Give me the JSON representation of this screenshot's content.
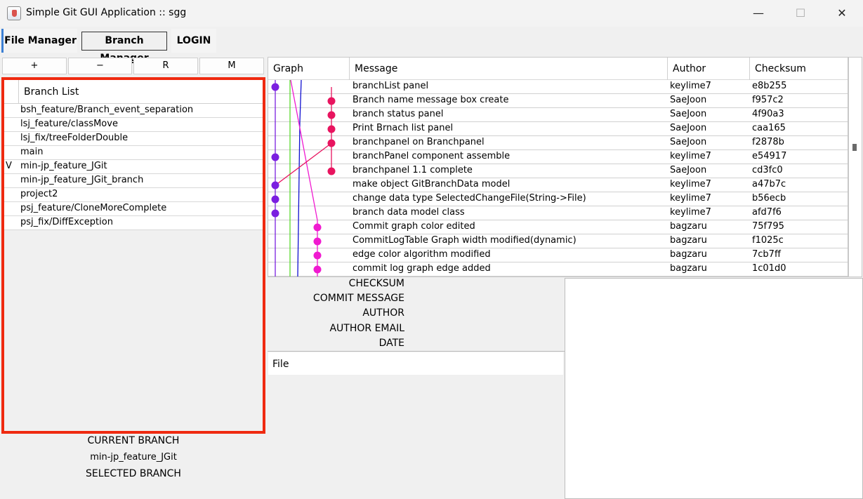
{
  "window": {
    "title": "Simple Git GUI Application :: sgg",
    "minimize": "—",
    "maximize": "☐",
    "close": "✕"
  },
  "tabs": [
    {
      "label": "File Manager"
    },
    {
      "label": "Branch Manager"
    },
    {
      "label": "LOGIN"
    }
  ],
  "branch_buttons": {
    "add": "+",
    "remove": "−",
    "rename": "R",
    "merge": "M"
  },
  "branch_list": {
    "header": "Branch List",
    "items": [
      {
        "mark": "",
        "name": "bsh_feature/Branch_event_separation"
      },
      {
        "mark": "",
        "name": "lsj_feature/classMove"
      },
      {
        "mark": "",
        "name": "lsj_fix/treeFolderDouble"
      },
      {
        "mark": "",
        "name": "main"
      },
      {
        "mark": "V",
        "name": "min-jp_feature_JGit"
      },
      {
        "mark": "",
        "name": "min-jp_feature_JGit_branch"
      },
      {
        "mark": "",
        "name": "project2"
      },
      {
        "mark": "",
        "name": "psj_feature/CloneMoreComplete"
      },
      {
        "mark": "",
        "name": "psj_fix/DiffException"
      }
    ]
  },
  "branch_info": {
    "current_label": "CURRENT BRANCH",
    "current_value": "min-jp_feature_JGit",
    "selected_label": "SELECTED BRANCH"
  },
  "commit_table": {
    "columns": {
      "graph": "Graph",
      "message": "Message",
      "author": "Author",
      "checksum": "Checksum"
    },
    "rows": [
      {
        "message": "branchList panel",
        "author": "keylime7",
        "checksum": "e8b255",
        "color": "#7b1fe0",
        "lane": 0
      },
      {
        "message": "Branch name message box create",
        "author": "SaeJoon",
        "checksum": "f957c2",
        "color": "#e8145f",
        "lane": 4
      },
      {
        "message": "branch status panel",
        "author": "SaeJoon",
        "checksum": "4f90a3",
        "color": "#e8145f",
        "lane": 4
      },
      {
        "message": "Print Brnach list panel",
        "author": "SaeJoon",
        "checksum": "caa165",
        "color": "#e8145f",
        "lane": 4
      },
      {
        "message": "branchpanel on Branchpanel",
        "author": "SaeJoon",
        "checksum": "f2878b",
        "color": "#e8145f",
        "lane": 4
      },
      {
        "message": "branchPanel component assemble",
        "author": "keylime7",
        "checksum": "e54917",
        "color": "#7b1fe0",
        "lane": 0
      },
      {
        "message": "branchpanel 1.1 complete",
        "author": "SaeJoon",
        "checksum": "cd3fc0",
        "color": "#e8145f",
        "lane": 4
      },
      {
        "message": "make object GitBranchData model",
        "author": "keylime7",
        "checksum": "a47b7c",
        "color": "#7b1fe0",
        "lane": 0
      },
      {
        "message": "change data type SelectedChangeFile(String->File)",
        "author": "keylime7",
        "checksum": "b56ecb",
        "color": "#7b1fe0",
        "lane": 0
      },
      {
        "message": "branch data model class",
        "author": "keylime7",
        "checksum": "afd7f6",
        "color": "#7b1fe0",
        "lane": 0
      },
      {
        "message": "Commit graph color edited",
        "author": "bagzaru",
        "checksum": "75f795",
        "color": "#f01ad0",
        "lane": 3
      },
      {
        "message": "CommitLogTable Graph width modified(dynamic)",
        "author": "bagzaru",
        "checksum": "f1025c",
        "color": "#f01ad0",
        "lane": 3
      },
      {
        "message": "edge color algorithm modified",
        "author": "bagzaru",
        "checksum": "7cb7ff",
        "color": "#f01ad0",
        "lane": 3
      },
      {
        "message": "commit log graph edge added",
        "author": "bagzaru",
        "checksum": "1c01d0",
        "color": "#f01ad0",
        "lane": 3
      }
    ]
  },
  "commit_details": {
    "checksum": "CHECKSUM",
    "message": "COMMIT MESSAGE",
    "author": "AUTHOR",
    "email": "AUTHOR EMAIL",
    "date": "DATE"
  },
  "file_panel": {
    "header": "File"
  },
  "colors": {
    "highlight_border": "#ef2a10",
    "tab_accent": "#3c7fd3"
  }
}
